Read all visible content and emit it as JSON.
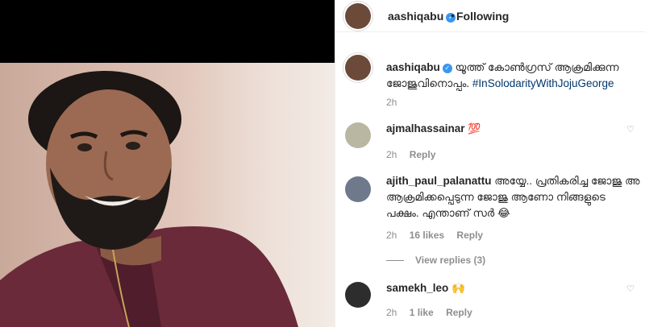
{
  "header": {
    "username": "aashiqabu",
    "separator": "•",
    "follow_state": "Following"
  },
  "caption": {
    "username": "aashiqabu",
    "text": "യൂത്ത് കോൺഗ്രസ് ആക്രമിക്കുന്ന ജോജുവിനൊപ്പം.",
    "hashtag": "#InSolodarityWithJojuGeorge",
    "time": "2h"
  },
  "comments": [
    {
      "username": "ajmalhassainar",
      "text": "",
      "emoji": "💯",
      "time": "2h",
      "likes": "",
      "reply_label": "Reply"
    },
    {
      "username": "ajith_paul_palanattu",
      "text": "അയ്യേ.. പ്രതികരിച്ച ജോജു അ ആക്രമിക്കപ്പെടുന്ന ജോജു ആണോ നിങ്ങളുടെ പക്ഷം. എന്താണ് സർ",
      "emoji": "😂",
      "time": "2h",
      "likes": "16 likes",
      "reply_label": "Reply",
      "view_replies": "View replies (3)"
    },
    {
      "username": "samekh_leo",
      "text": "",
      "emoji": "🙌",
      "time": "2h",
      "likes": "1 like",
      "reply_label": "Reply"
    }
  ],
  "icons": {
    "verified": "verified-badge-icon",
    "like": "heart-outline-icon"
  },
  "colors": {
    "hashtag": "#00376b",
    "verified": "#3897f0",
    "muted": "#8e8e8e",
    "shirt": "#6a2a3a"
  }
}
